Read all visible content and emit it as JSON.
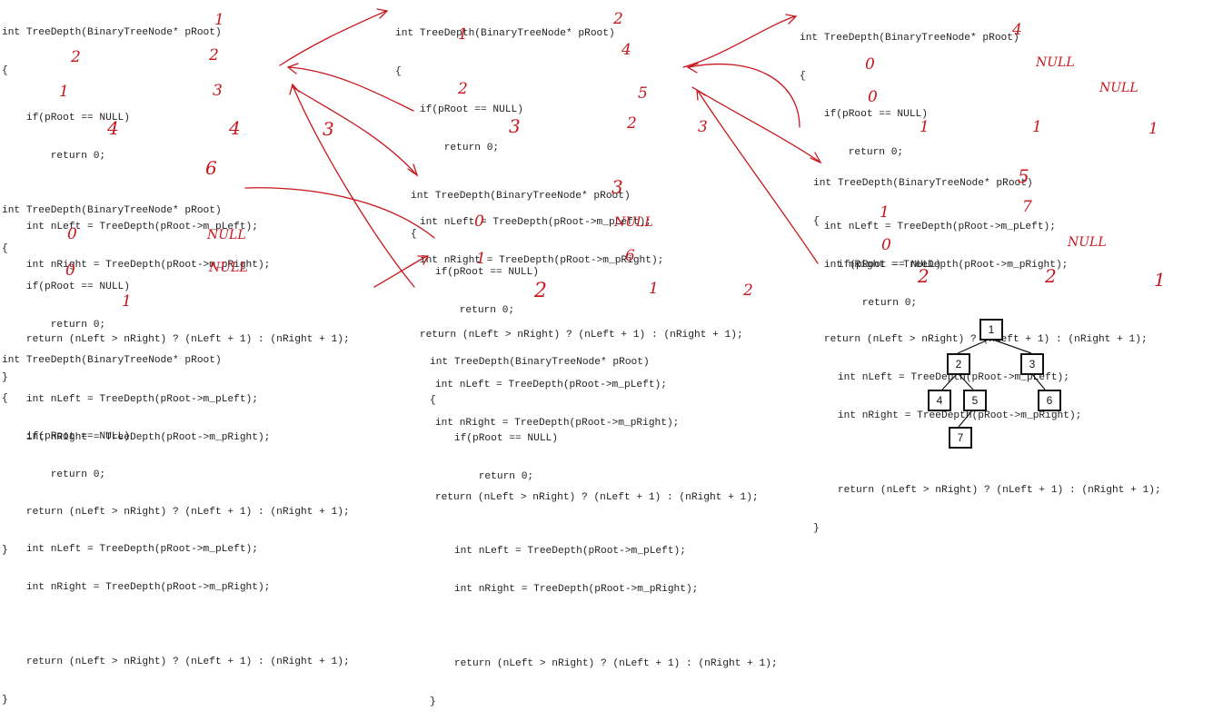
{
  "code_lines": [
    "int TreeDepth(BinaryTreeNode* pRoot)",
    "{",
    "    if(pRoot == NULL)",
    "        return 0;",
    "",
    "    int nLeft = TreeDepth(pRoot->m_pLeft);",
    "    int nRight = TreeDepth(pRoot->m_pRight);",
    "",
    "    return (nLeft > nRight) ? (nLeft + 1) : (nRight + 1);",
    "}"
  ],
  "annotations": {
    "b1": [
      "1",
      "2",
      "2",
      "1",
      "3",
      "4",
      "4",
      "3"
    ],
    "b2": [
      "2",
      "1",
      "4",
      "2",
      "5",
      "3",
      "2",
      "3"
    ],
    "b3": [
      "4",
      "0",
      "NULL",
      "0",
      "NULL",
      "1",
      "1",
      "1"
    ],
    "b4": [
      "6",
      "0",
      "NULL",
      "0",
      "NULL",
      "1"
    ],
    "b5": [
      "3",
      "0",
      "NULL",
      "1",
      "6",
      "2",
      "1",
      "2"
    ],
    "b6": [
      "5",
      "1",
      "7",
      "0",
      "NULL",
      "2",
      "2",
      "1"
    ]
  },
  "tree": {
    "nodes": [
      "1",
      "2",
      "3",
      "4",
      "5",
      "6",
      "7"
    ]
  },
  "colors": {
    "annotation": "#c8161d",
    "code": "#222222",
    "tree_border": "#111111"
  }
}
